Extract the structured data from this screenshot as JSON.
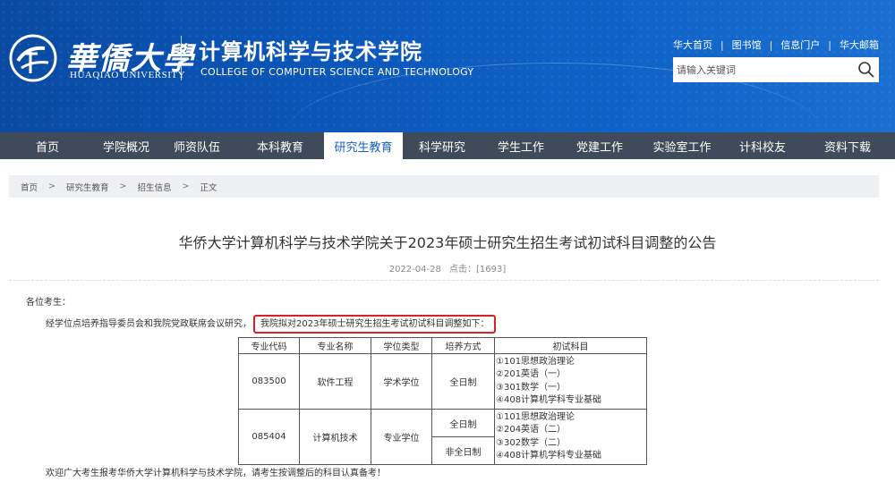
{
  "header": {
    "university_cn": "華僑大學",
    "university_en": "HUAQIAO UNIVERSITY",
    "college_cn": "计算机科学与技术学院",
    "college_en": "COLLEGE OF COMPUTER SCIENCE AND TECHNOLOGY",
    "top_links": [
      "华大首页",
      "图书馆",
      "信息门户",
      "华大邮箱"
    ],
    "search_placeholder": "请输入关键词",
    "colors": {
      "header_blue": "#0b56b8",
      "nav_bg": "#3f4b5b",
      "active_text": "#1760c0",
      "highlight_red": "#e02020"
    }
  },
  "nav": {
    "items": [
      "首页",
      "学院概况",
      "师资队伍",
      "本科教育",
      "研究生教育",
      "科学研究",
      "学生工作",
      "党建工作",
      "实验室工作",
      "计科校友",
      "资料下载"
    ],
    "active_index": 4
  },
  "breadcrumb": [
    "首页",
    "研究生教育",
    "招生信息",
    "正文"
  ],
  "article": {
    "title": "华侨大学计算机科学与技术学院关于2023年硕士研究生招生考试初试科目调整的公告",
    "date": "2022-04-28",
    "views_label": "点击：[1693]",
    "greeting": "各位考生：",
    "para1_prefix": "经学位点培养指导委员会和我院党政联席会议研究，",
    "para1_highlight": "我院拟对2023年硕士研究生招生考试初试科目调整如下：",
    "closing": "欢迎广大考生报考华侨大学计算机科学与技术学院，请考生按调整后的科目认真备考！"
  },
  "table": {
    "headers": [
      "专业代码",
      "专业名称",
      "学位类型",
      "培养方式",
      "初试科目"
    ],
    "rows": [
      {
        "code": "083500",
        "name": "软件工程",
        "degree": "学术学位",
        "modes": [
          "全日制"
        ],
        "subjects": [
          "①101思想政治理论",
          "②201英语（一）",
          "③301数学（一）",
          "④408计算机学科专业基础"
        ]
      },
      {
        "code": "085404",
        "name": "计算机技术",
        "degree": "专业学位",
        "modes": [
          "全日制",
          "非全日制"
        ],
        "subjects": [
          "①101思想政治理论",
          "②204英语（二）",
          "③302数学（二）",
          "④408计算机学科专业基础"
        ]
      }
    ]
  }
}
